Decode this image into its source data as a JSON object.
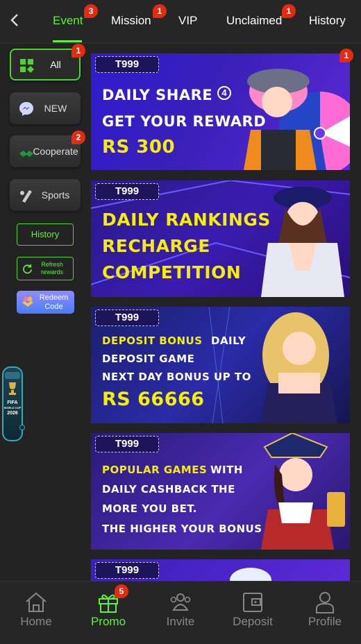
{
  "header": {
    "tabs": [
      {
        "label": "Event",
        "badge": "3",
        "active": true
      },
      {
        "label": "Mission",
        "badge": "1"
      },
      {
        "label": "VIP"
      },
      {
        "label": "Unclaimed",
        "badge": "1"
      },
      {
        "label": "History"
      }
    ]
  },
  "sidebar": {
    "categories": [
      {
        "label": "All",
        "badge": "1",
        "icon": "grid-icon",
        "active": true
      },
      {
        "label": "NEW",
        "icon": "messenger-icon"
      },
      {
        "label": "Cooperate",
        "badge": "2",
        "icon": "handshake-icon"
      },
      {
        "label": "Sports",
        "icon": "sports-icon"
      }
    ],
    "history_label": "History",
    "refresh_label_1": "Refresh",
    "refresh_label_2": "rewards",
    "redeem_label_1": "Redeem",
    "redeem_label_2": "Code"
  },
  "banners": [
    {
      "tag": "T999",
      "badge": "1",
      "lines": [
        "DAILY SHARE",
        "GET YOUR REWARD",
        "RS 300"
      ],
      "circle_number": "4"
    },
    {
      "tag": "T999",
      "lines": [
        "DAILY RANKINGS",
        "RECHARGE",
        "COMPETITION"
      ]
    },
    {
      "tag": "T999",
      "lines": [
        "DEPOSIT BONUS",
        "DAILY",
        "DEPOSIT GAME",
        "NEXT DAY BONUS UP TO",
        "RS 66666"
      ]
    },
    {
      "tag": "T999",
      "lines": [
        "POPULAR GAMES",
        "WITH",
        "DAILY CASHBACK THE",
        "MORE YOU BET.",
        "THE HIGHER YOUR BONUS"
      ]
    },
    {
      "tag": "T999"
    }
  ],
  "widget": {
    "lines": [
      "FIFA",
      "WORLD CUP",
      "2026"
    ]
  },
  "bottom_nav": [
    {
      "label": "Home",
      "icon": "home-icon"
    },
    {
      "label": "Promo",
      "icon": "gift-icon",
      "badge": "5",
      "active": true
    },
    {
      "label": "Invite",
      "icon": "invite-icon"
    },
    {
      "label": "Deposit",
      "icon": "wallet-icon"
    },
    {
      "label": "Profile",
      "icon": "profile-icon"
    }
  ],
  "colors": {
    "accent": "#5ff03e",
    "badge": "#e22b10",
    "background": "#232323",
    "yellow_text": "#f6f000"
  }
}
